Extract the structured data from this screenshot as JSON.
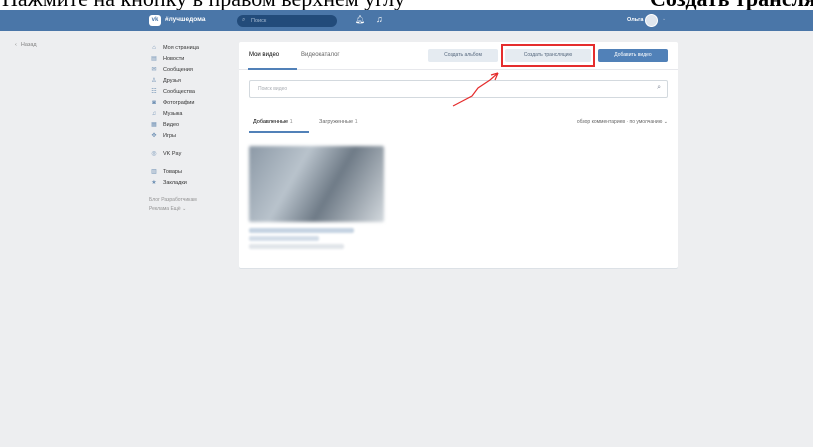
{
  "caption": {
    "left": "Нажмите на кнопку в правом верхнем углу",
    "right": "Создать трансляцию"
  },
  "header": {
    "logo": "vk",
    "brand": "#лучшедома",
    "search_placeholder": "Поиск",
    "user_name": "Ольга"
  },
  "back_label": "Назад",
  "sidebar": {
    "items": [
      {
        "icon": "home-icon",
        "glyph": "⌂",
        "label": "Моя страница"
      },
      {
        "icon": "news-icon",
        "glyph": "▤",
        "label": "Новости"
      },
      {
        "icon": "messages-icon",
        "glyph": "✉",
        "label": "Сообщения"
      },
      {
        "icon": "friends-icon",
        "glyph": "♙",
        "label": "Друзья"
      },
      {
        "icon": "communities-icon",
        "glyph": "☷",
        "label": "Сообщества"
      },
      {
        "icon": "photos-icon",
        "glyph": "◙",
        "label": "Фотографии"
      },
      {
        "icon": "music-icon",
        "glyph": "♫",
        "label": "Музыка"
      },
      {
        "icon": "video-icon",
        "glyph": "▦",
        "label": "Видео"
      },
      {
        "icon": "games-icon",
        "glyph": "✥",
        "label": "Игры"
      }
    ],
    "items2": [
      {
        "icon": "vkpay-icon",
        "glyph": "◎",
        "label": "VK Pay"
      }
    ],
    "items3": [
      {
        "icon": "goods-icon",
        "glyph": "▥",
        "label": "Товары"
      },
      {
        "icon": "bookmarks-icon",
        "glyph": "★",
        "label": "Закладки"
      }
    ],
    "footer_line1": "Блог   Разработчикам",
    "footer_line2": "Реклама   Ещё ⌄"
  },
  "video": {
    "tab_my": "Мои видео",
    "tab_catalog": "Видеокаталог",
    "btn_album": "Создать альбом",
    "btn_stream": "Создать трансляцию",
    "btn_add": "Добавить видео",
    "search_placeholder": "Поиск видео",
    "subtab_added": "Добавленные",
    "subtab_added_count": "1",
    "subtab_uploaded": "Загруженные",
    "subtab_uploaded_count": "1",
    "sort_label": "обзор комментариев · по умолчанию ⌄"
  },
  "colors": {
    "header": "#4a76a8",
    "primary": "#5181b8",
    "highlight": "#e52d2d"
  }
}
